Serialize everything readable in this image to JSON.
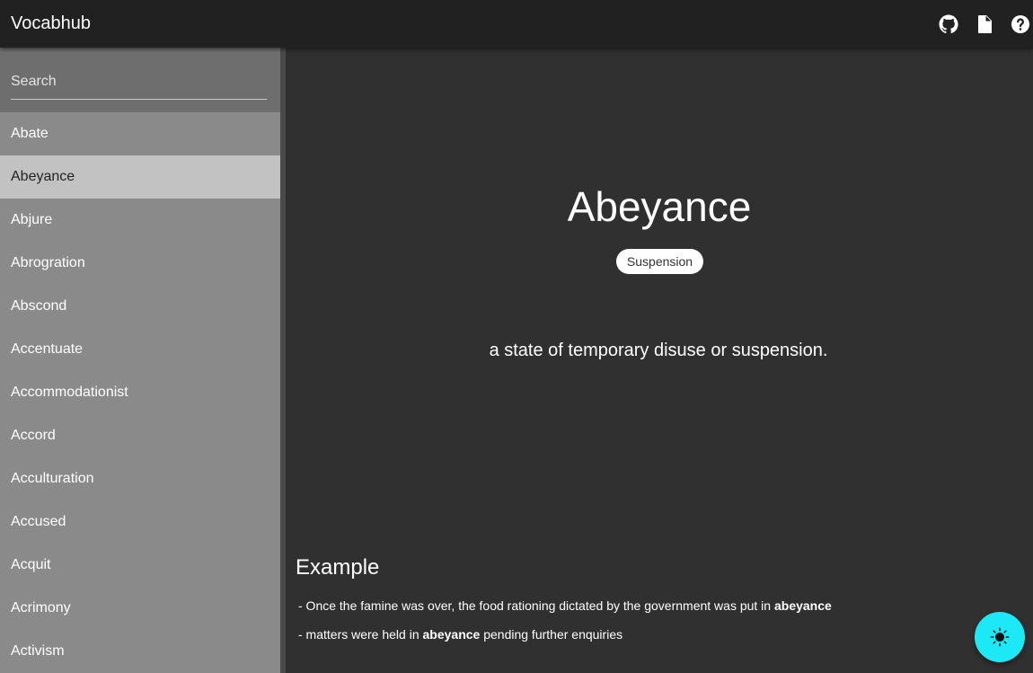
{
  "appbar": {
    "title": "Vocabhub",
    "icons": [
      "github-icon",
      "document-icon",
      "help-icon"
    ]
  },
  "search": {
    "placeholder": "Search",
    "value": ""
  },
  "sidebar": {
    "items": [
      {
        "label": "Abate"
      },
      {
        "label": "Abeyance"
      },
      {
        "label": "Abjure"
      },
      {
        "label": "Abrogration"
      },
      {
        "label": "Abscond"
      },
      {
        "label": "Accentuate"
      },
      {
        "label": "Accommodationist"
      },
      {
        "label": "Accord"
      },
      {
        "label": "Acculturation"
      },
      {
        "label": "Accused"
      },
      {
        "label": "Acquit"
      },
      {
        "label": "Acrimony"
      },
      {
        "label": "Activism"
      }
    ],
    "selected": "Abeyance"
  },
  "word": {
    "title": "Abeyance",
    "synonym": "Suspension",
    "definition": "a state of temporary disuse or suspension."
  },
  "example": {
    "heading": "Example",
    "lines": [
      {
        "before": "- Once the famine was over, the food rationing dictated by the government was put in ",
        "bold": "abeyance",
        "after": ""
      },
      {
        "before": "- matters were held in ",
        "bold": "abeyance",
        "after": " pending further enquiries"
      }
    ]
  },
  "fab": {
    "icon": "brightness-icon"
  },
  "colors": {
    "appbar": "#212121",
    "sidebar": "#8a8a8a",
    "selected_item": "#c2c2c2",
    "main_bg": "#303030",
    "fab": "#1de9f6"
  }
}
